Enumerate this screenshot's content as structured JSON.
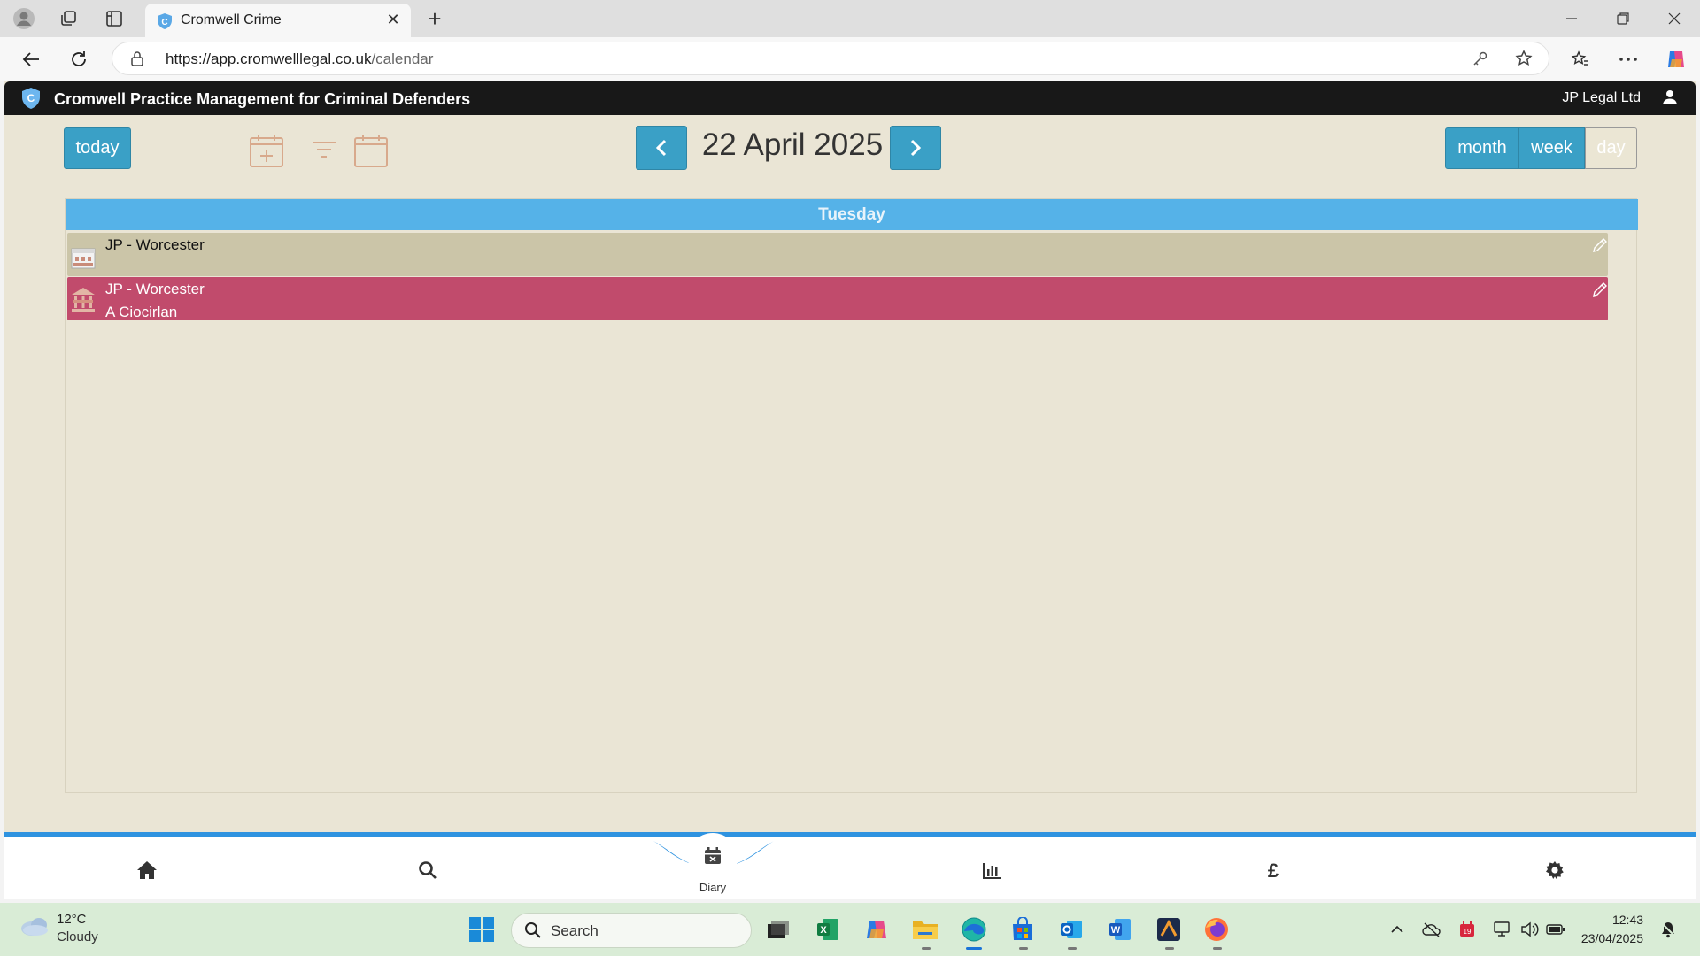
{
  "browser": {
    "tab_title": "Cromwell Crime",
    "url_host": "https://app.cromwelllegal.co.uk",
    "url_path": "/calendar"
  },
  "app": {
    "title": "Cromwell Practice Management for Criminal Defenders",
    "user": "JP Legal Ltd",
    "logo_letter": "C",
    "toolbar": {
      "today_label": "today",
      "date_title": "22 April 2025",
      "views": {
        "month": "month",
        "week": "week",
        "day": "day"
      },
      "active_view": "day"
    },
    "calendar": {
      "day_header": "Tuesday",
      "events": [
        {
          "title": "JP - Worcester",
          "subtitle": "",
          "color": "#cbc5a8"
        },
        {
          "title": "JP - Worcester",
          "subtitle": "A Ciocirlan",
          "color": "#c14b6c"
        }
      ]
    },
    "bottom_nav": {
      "items": [
        "home-icon",
        "search-icon",
        "diary-icon",
        "chart-icon",
        "pound-icon",
        "gear-icon"
      ],
      "active": "Diary",
      "diary_label": "Diary"
    },
    "colors": {
      "accent": "#3aa0c6",
      "header_bar": "#55b2e8",
      "background": "#eae5d5"
    }
  },
  "taskbar": {
    "weather_temp": "12°C",
    "weather_desc": "Cloudy",
    "search_label": "Search",
    "time": "12:43",
    "date": "23/04/2025"
  }
}
